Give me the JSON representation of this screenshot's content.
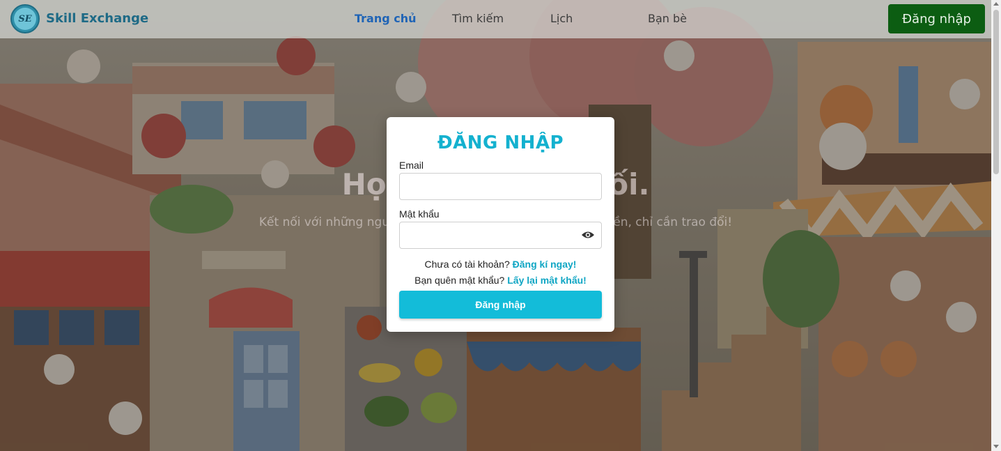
{
  "header": {
    "brand": "Skill Exchange",
    "logo_text": "SE",
    "nav": [
      {
        "label": "Trang chủ",
        "active": true
      },
      {
        "label": "Tìm kiếm",
        "active": false
      },
      {
        "label": "Lịch",
        "active": false
      },
      {
        "label": "Bạn bè",
        "active": false
      }
    ],
    "login_button": "Đăng nhập"
  },
  "hero": {
    "title": "Học hỏi và kết nối.",
    "subtitle": "Kết nối với những người cùng đam mê, học hỏi không cần tiền, chỉ cần trao đổi!"
  },
  "modal": {
    "title": "ĐĂNG NHẬP",
    "email_label": "Email",
    "email_value": "",
    "password_label": "Mật khẩu",
    "password_value": "",
    "password_toggle_icon": "eye-icon",
    "no_account_text": "Chưa có tài khoản?",
    "register_link": "Đăng kí ngay!",
    "forgot_text": "Bạn quên mật khẩu?",
    "recover_link": "Lấy lại mật khẩu!",
    "submit": "Đăng nhập"
  },
  "colors": {
    "accent": "#13bcd9",
    "title": "#14b1cf",
    "login_button": "#0c5d12",
    "nav_active": "#1f64b6",
    "brand": "#1e6a86"
  }
}
